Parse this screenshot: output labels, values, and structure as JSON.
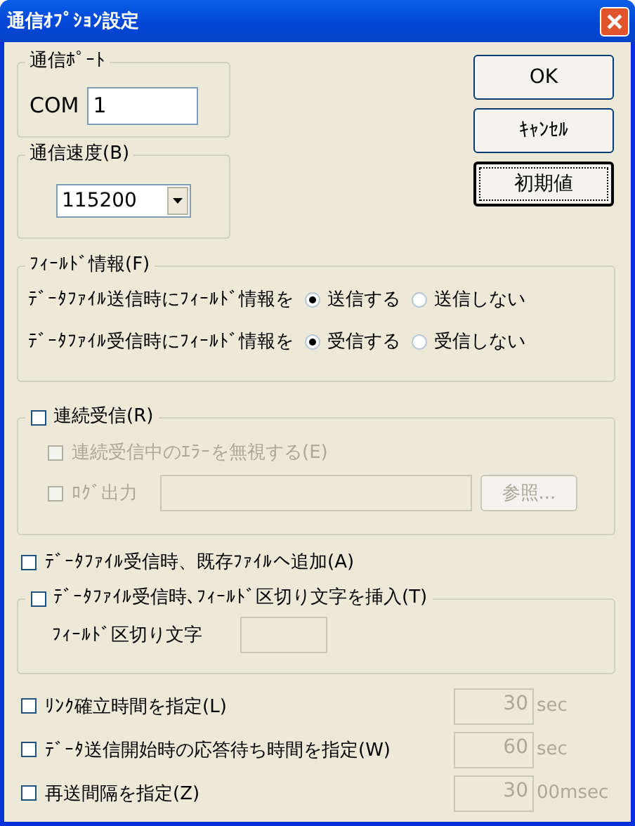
{
  "window": {
    "title": "通信ｵﾌﾟｼｮﾝ設定"
  },
  "port": {
    "legend": "通信ﾎﾟｰﾄ",
    "label": "COM",
    "value": "1"
  },
  "speed": {
    "legend": "通信速度(B)",
    "value": "115200"
  },
  "buttons": [
    {
      "label": "OK",
      "default": false
    },
    {
      "label": "ｷｬﾝｾﾙ",
      "default": false
    },
    {
      "label": "初期値",
      "default": true
    }
  ],
  "field_info": {
    "legend": "ﾌｨｰﾙﾄﾞ情報(F)",
    "rows": [
      {
        "label": "ﾃﾞｰﾀﾌｧｲﾙ送信時にﾌｨｰﾙﾄﾞ情報を",
        "options": [
          {
            "label": "送信する",
            "selected": true
          },
          {
            "label": "送信しない",
            "selected": false
          }
        ]
      },
      {
        "label": "ﾃﾞｰﾀﾌｧｲﾙ受信時にﾌｨｰﾙﾄﾞ情報を",
        "options": [
          {
            "label": "受信する",
            "selected": true
          },
          {
            "label": "受信しない",
            "selected": false
          }
        ]
      }
    ]
  },
  "continuous": {
    "label": "連続受信(R)",
    "checked": false,
    "items": [
      {
        "kind": "checkbox",
        "label": "連続受信中のｴﾗｰを無視する(E)",
        "checked": false,
        "disabled": true
      },
      {
        "kind": "log",
        "label": "ﾛｸﾞ出力",
        "checked": false,
        "disabled": true,
        "button": "参照..."
      }
    ]
  },
  "append": {
    "label": "ﾃﾞｰﾀﾌｧｲﾙ受信時、既存ﾌｧｲﾙへ追加(A)",
    "checked": false
  },
  "delimiter": {
    "label": "ﾃﾞｰﾀﾌｧｲﾙ受信時､ﾌｨｰﾙﾄﾞ区切り文字を挿入(T)",
    "checked": false,
    "field_label": "ﾌｨｰﾙﾄﾞ区切り文字"
  },
  "timers": [
    {
      "label": "ﾘﾝｸ確立時間を指定(L)",
      "checked": false,
      "value": "30",
      "unit": "sec",
      "disabled": true
    },
    {
      "label": "ﾃﾞｰﾀ送信開始時の応答待ち時間を指定(W)",
      "checked": false,
      "value": "60",
      "unit": "sec",
      "disabled": true
    },
    {
      "label": "再送間隔を指定(Z)",
      "checked": false,
      "value": "30",
      "unit": "00msec",
      "disabled": true
    }
  ]
}
